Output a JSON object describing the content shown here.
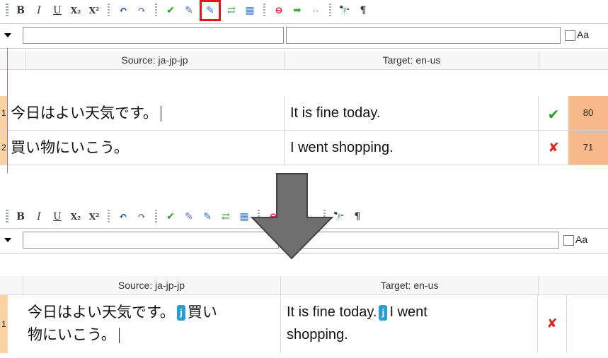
{
  "toolbar": {
    "buttons": [
      {
        "name": "bold-button",
        "glyph": "B"
      },
      {
        "name": "italic-button",
        "glyph": "I"
      },
      {
        "name": "underline-button",
        "glyph": "U"
      },
      {
        "name": "subscript-button",
        "glyph": "X₂"
      },
      {
        "name": "superscript-button",
        "glyph": "X²"
      },
      {
        "name": "undo-button",
        "glyph": "↶"
      },
      {
        "name": "redo-button",
        "glyph": "↷"
      },
      {
        "name": "confirm-button",
        "glyph": "✔"
      },
      {
        "name": "split-segment-button",
        "glyph": "✎"
      },
      {
        "name": "join-segments-button",
        "glyph": "✎"
      },
      {
        "name": "swap-button",
        "glyph": "⇄"
      },
      {
        "name": "insert-button",
        "glyph": "▦"
      },
      {
        "name": "stop-button",
        "glyph": "⊖"
      },
      {
        "name": "next-button",
        "glyph": "➡"
      },
      {
        "name": "tags-button",
        "glyph": "‹›"
      },
      {
        "name": "find-button",
        "glyph": "🔭"
      },
      {
        "name": "pilcrow-button",
        "glyph": "¶"
      }
    ]
  },
  "filter": {
    "source_value": "",
    "target_value": "",
    "case_label": "Aa"
  },
  "grid": {
    "source_header": "Source: ja-jp-jp",
    "target_header": "Target: en-us"
  },
  "before": {
    "rows": [
      {
        "num": "1",
        "source": "今日はよい天気です。",
        "target": "It is fine today.",
        "status": "✔",
        "score": "80"
      },
      {
        "num": "2",
        "source": "買い物にいこう。",
        "target": "I went shopping.",
        "status": "✘",
        "score": "71"
      }
    ]
  },
  "after": {
    "row": {
      "num": "1",
      "source_a": "今日はよい天気です。",
      "tag_a": "j",
      "source_b": "買い",
      "source_c": "物にいこう。",
      "target_a": "It is fine today.",
      "tag_b": "j",
      "target_b": "I went",
      "target_c": "shopping.",
      "status": "✘"
    }
  },
  "colors": {
    "highlight": "#e0161b",
    "arrow": "#6e6e6e",
    "score_bg": "#f7b98a",
    "tag": "#2a9fd6"
  }
}
